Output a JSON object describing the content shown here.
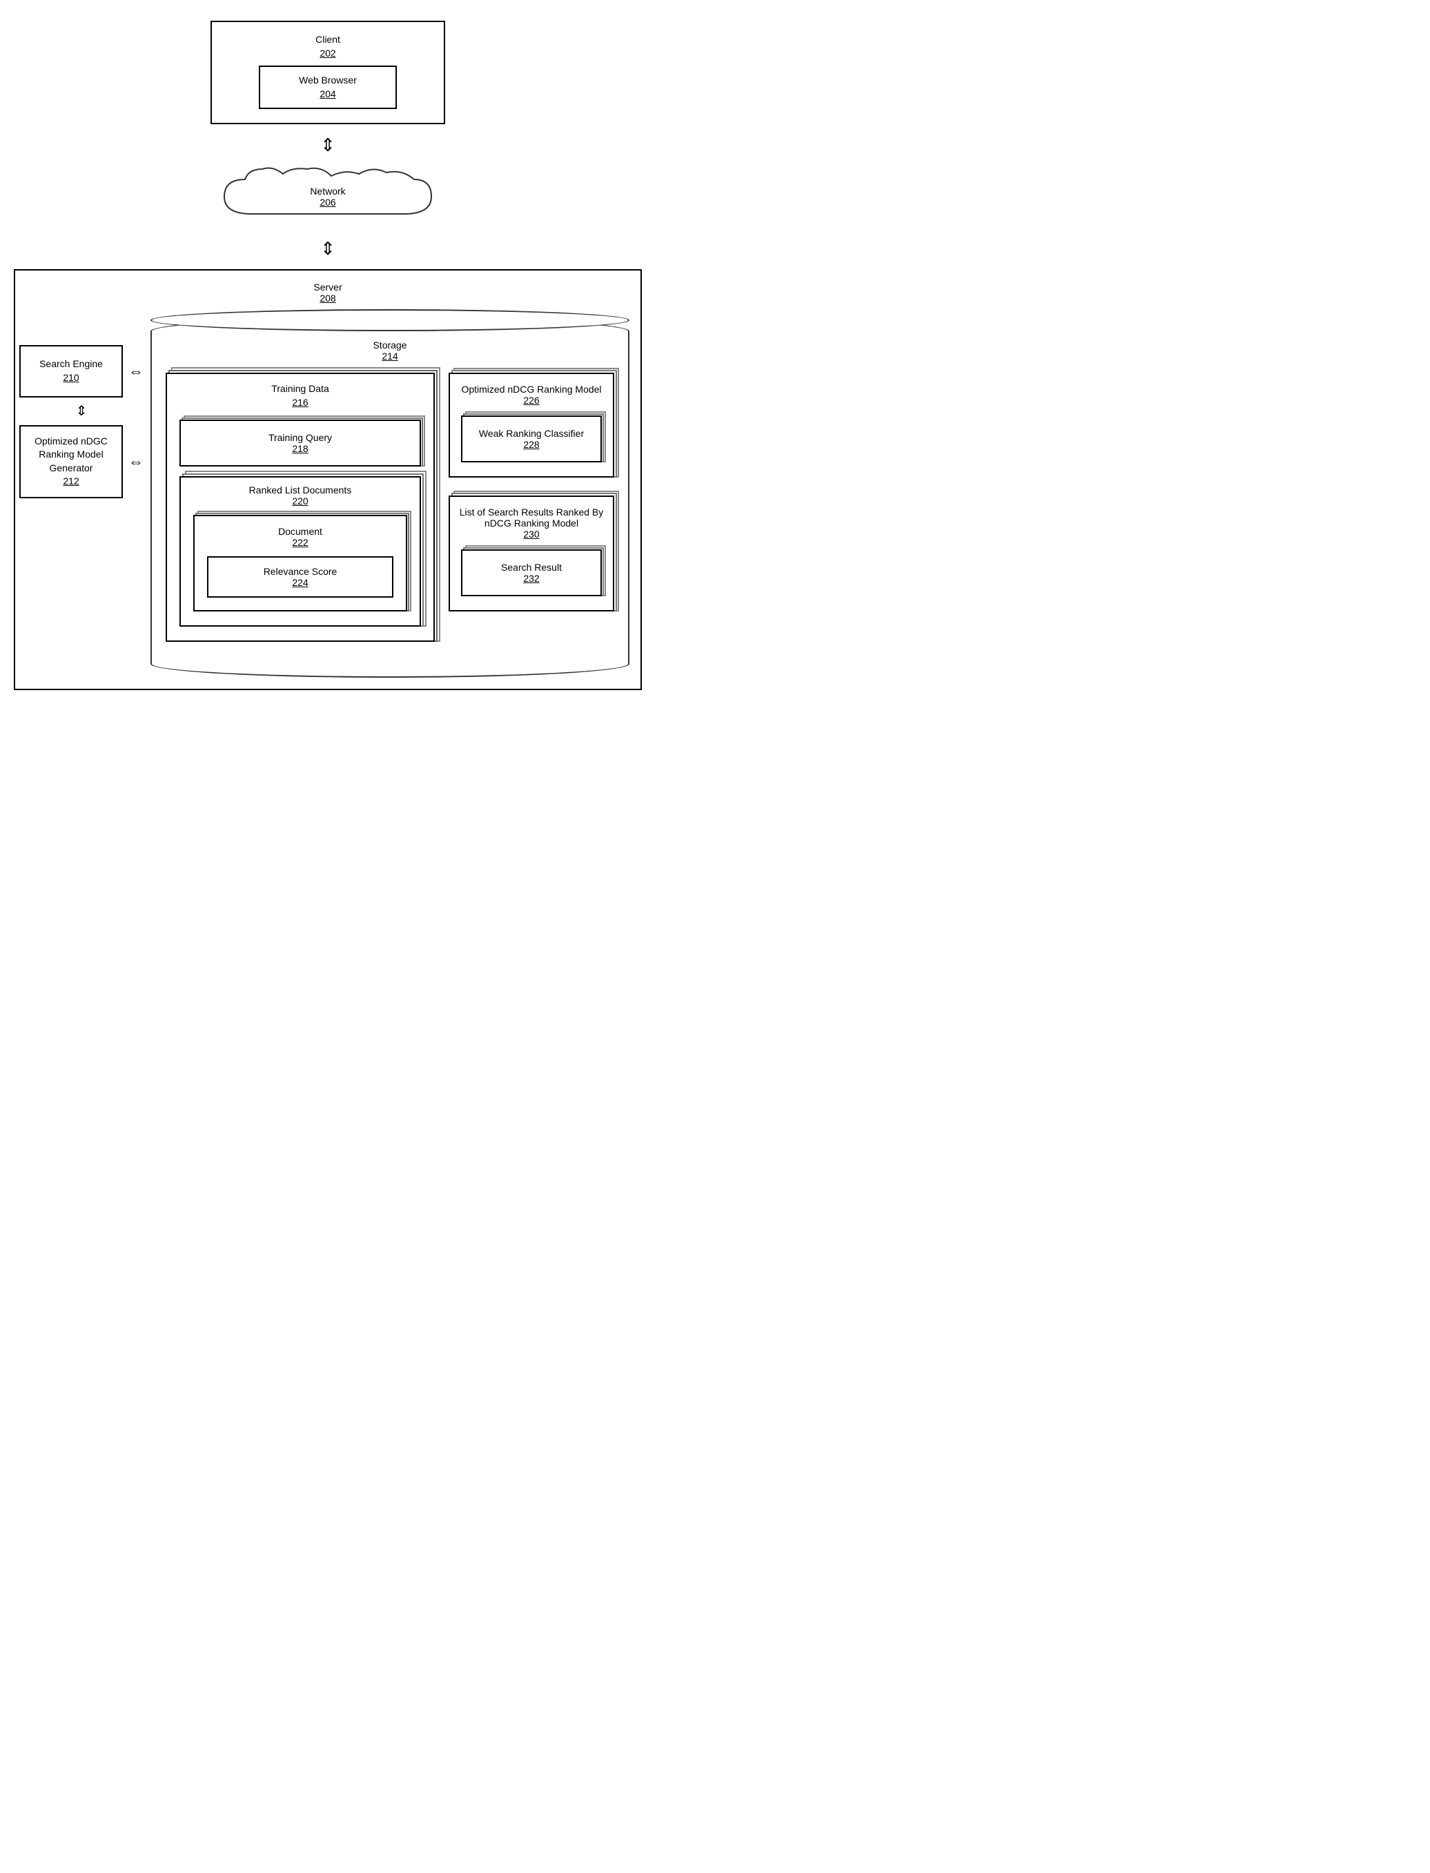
{
  "client": {
    "label": "Client",
    "num": "202",
    "web_browser": {
      "label": "Web Browser",
      "num": "204"
    }
  },
  "network": {
    "label": "Network",
    "num": "206"
  },
  "server": {
    "label": "Server",
    "num": "208"
  },
  "search_engine": {
    "label": "Search Engine",
    "num": "210"
  },
  "ndgc_gen": {
    "label": "Optimized nDGC Ranking Model Generator",
    "num": "212"
  },
  "storage": {
    "label": "Storage",
    "num": "214"
  },
  "training_data": {
    "label": "Training Data",
    "num": "216"
  },
  "training_query": {
    "label": "Training Query",
    "num": "218"
  },
  "ranked_list": {
    "label": "Ranked List Documents",
    "num": "220"
  },
  "document": {
    "label": "Document",
    "num": "222"
  },
  "relevance_score": {
    "label": "Relevance Score",
    "num": "224"
  },
  "optimized_ndcg": {
    "label": "Optimized nDCG Ranking Model",
    "num": "226"
  },
  "weak_ranking": {
    "label": "Weak Ranking Classifier",
    "num": "228"
  },
  "search_results_list": {
    "label": "List of Search Results Ranked By nDCG Ranking Model",
    "num": "230"
  },
  "search_result": {
    "label": "Search Result",
    "num": "232"
  },
  "arrows": {
    "double_vert": "⇕",
    "double_horiz": "⇔"
  }
}
